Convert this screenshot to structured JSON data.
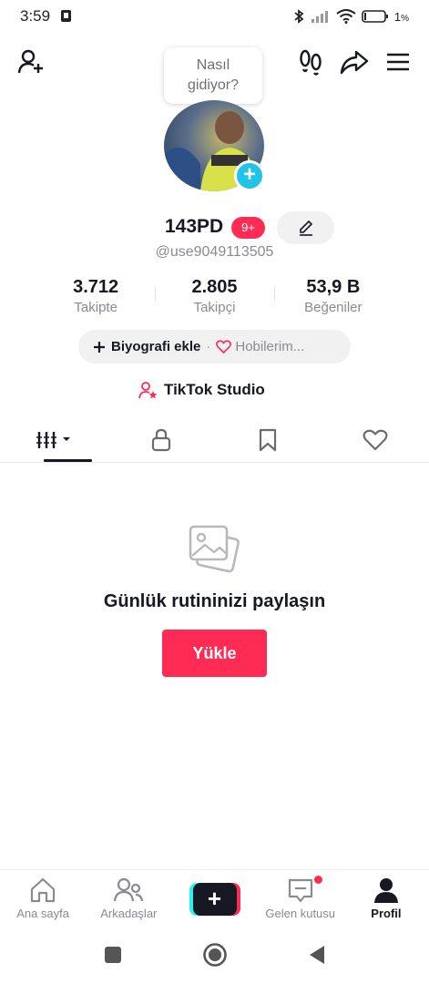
{
  "status_bar": {
    "time": "3:59",
    "battery_percent": "1",
    "battery_unit": "%",
    "icons": [
      "sim-alert-icon",
      "bluetooth-icon",
      "signal-off-icon",
      "wifi-icon",
      "battery-icon"
    ]
  },
  "top_bar": {
    "icons": [
      "add-friend-icon",
      "footprints-icon",
      "share-icon",
      "menu-icon"
    ]
  },
  "bubble": {
    "line1": "Nasıl",
    "line2": "gidiyor?"
  },
  "profile": {
    "username": "143PD",
    "badge": "9+",
    "handle": "@use9049113505"
  },
  "stats": [
    {
      "value": "3.712",
      "label": "Takipte"
    },
    {
      "value": "2.805",
      "label": "Takipçi"
    },
    {
      "value": "53,9 B",
      "label": "Beğeniler"
    }
  ],
  "bio": {
    "add_label": "Biyografi ekle",
    "separator": "·",
    "hobby_label": "Hobilerim..."
  },
  "studio": {
    "label": "TikTok Studio"
  },
  "tabs": [
    {
      "icon": "videos-grid-icon",
      "active": true
    },
    {
      "icon": "lock-icon",
      "active": false
    },
    {
      "icon": "bookmark-icon",
      "active": false
    },
    {
      "icon": "heart-icon",
      "active": false
    }
  ],
  "empty_state": {
    "icon": "photos-icon",
    "title": "Günlük rutininizi paylaşın",
    "button": "Yükle"
  },
  "bottom_nav": {
    "items": [
      {
        "label": "Ana sayfa",
        "icon": "home-icon"
      },
      {
        "label": "Arkadaşlar",
        "icon": "friends-icon"
      },
      {
        "label": "",
        "icon": "create-plus-icon"
      },
      {
        "label": "Gelen kutusu",
        "icon": "inbox-icon"
      },
      {
        "label": "Profil",
        "icon": "profile-icon",
        "active": true
      }
    ],
    "create_symbol": "+"
  },
  "colors": {
    "accent": "#fe2c55",
    "cyan": "#25f4ee",
    "text": "#161823",
    "muted": "#8a8b91"
  }
}
